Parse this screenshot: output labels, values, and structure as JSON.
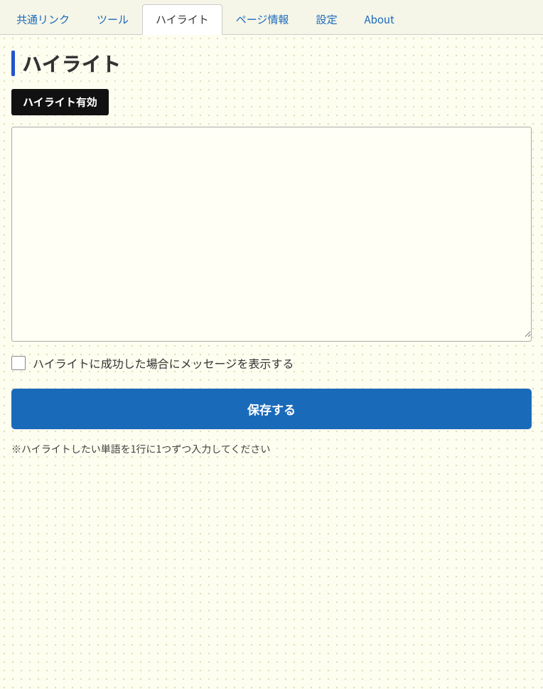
{
  "tabs": [
    {
      "id": "shared-link",
      "label": "共通リンク",
      "active": false
    },
    {
      "id": "tools",
      "label": "ツール",
      "active": false
    },
    {
      "id": "highlight",
      "label": "ハイライト",
      "active": true
    },
    {
      "id": "page-info",
      "label": "ページ情報",
      "active": false
    },
    {
      "id": "settings",
      "label": "設定",
      "active": false
    },
    {
      "id": "about",
      "label": "About",
      "active": false
    }
  ],
  "page": {
    "title": "ハイライト",
    "badge_label": "ハイライト有効",
    "textarea_placeholder": "",
    "checkbox_label": "ハイライトに成功した場合にメッセージを表示する",
    "save_button_label": "保存する",
    "hint_text": "※ハイライトしたい単語を1行に1つずつ入力してください"
  }
}
